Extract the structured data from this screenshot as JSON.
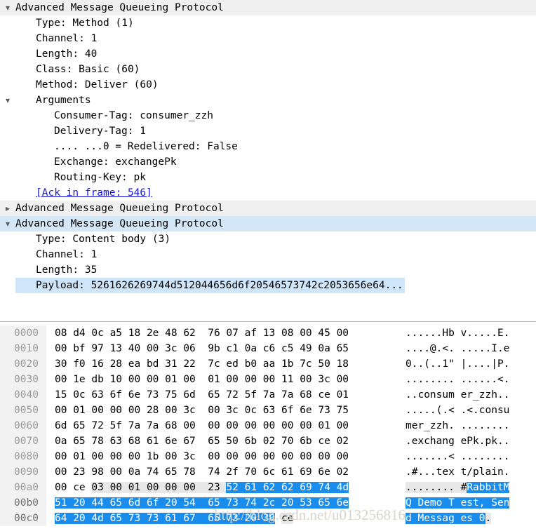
{
  "detail_pane": {
    "rows": [
      {
        "twisty": "chevron-down-icon",
        "indent": 1,
        "text": "Advanced Message Queueing Protocol",
        "bg": "gray",
        "name": "tree-item-amqp-method"
      },
      {
        "twisty": "none",
        "indent": 2,
        "text": "Type: Method (1)",
        "bg": "none",
        "name": "tree-item-type"
      },
      {
        "twisty": "none",
        "indent": 2,
        "text": "Channel: 1",
        "bg": "none",
        "name": "tree-item-channel"
      },
      {
        "twisty": "none",
        "indent": 2,
        "text": "Length: 40",
        "bg": "none",
        "name": "tree-item-length"
      },
      {
        "twisty": "none",
        "indent": 2,
        "text": "Class: Basic (60)",
        "bg": "none",
        "name": "tree-item-class"
      },
      {
        "twisty": "none",
        "indent": 2,
        "text": "Method: Deliver (60)",
        "bg": "none",
        "name": "tree-item-method"
      },
      {
        "twisty": "chevron-down-icon",
        "indent": 2,
        "text": "Arguments",
        "bg": "none",
        "name": "tree-item-arguments"
      },
      {
        "twisty": "none",
        "indent": 3,
        "text": "Consumer-Tag: consumer_zzh",
        "bg": "none",
        "name": "tree-item-consumer-tag"
      },
      {
        "twisty": "none",
        "indent": 3,
        "text": "Delivery-Tag: 1",
        "bg": "none",
        "name": "tree-item-delivery-tag"
      },
      {
        "twisty": "none",
        "indent": 3,
        "text": ".... ...0 = Redelivered: False",
        "bg": "none",
        "name": "tree-item-redelivered"
      },
      {
        "twisty": "none",
        "indent": 3,
        "text": "Exchange: exchangePk",
        "bg": "none",
        "name": "tree-item-exchange"
      },
      {
        "twisty": "none",
        "indent": 3,
        "text": "Routing-Key: pk",
        "bg": "none",
        "name": "tree-item-routing-key"
      },
      {
        "twisty": "none",
        "indent": 2,
        "text": "[Ack in frame: 546]",
        "bg": "none",
        "link": true,
        "name": "tree-item-ack-in-frame"
      },
      {
        "twisty": "chevron-right-icon",
        "indent": 1,
        "text": "Advanced Message Queueing Protocol",
        "bg": "gray",
        "name": "tree-item-amqp-header"
      },
      {
        "twisty": "chevron-down-icon",
        "indent": 1,
        "text": "Advanced Message Queueing Protocol",
        "bg": "blue",
        "name": "tree-item-amqp-body"
      },
      {
        "twisty": "none",
        "indent": 2,
        "text": "Type: Content body (3)",
        "bg": "none",
        "name": "tree-item-type-body"
      },
      {
        "twisty": "none",
        "indent": 2,
        "text": "Channel: 1",
        "bg": "none",
        "name": "tree-item-channel-body"
      },
      {
        "twisty": "none",
        "indent": 2,
        "text": "Length: 35",
        "bg": "none",
        "name": "tree-item-length-body"
      },
      {
        "twisty": "none",
        "indent": 2,
        "text": "Payload: 5261626269744d512044656d6f20546573742c2053656e64...",
        "bg": "none",
        "highlight": true,
        "name": "tree-item-payload"
      }
    ]
  },
  "hex_pane": {
    "rows": [
      {
        "offset": "0000",
        "bytes": "08 d4 0c a5 18 2e 48 62  76 07 af 13 08 00 45 00",
        "ascii": "......Hb v.....E."
      },
      {
        "offset": "0010",
        "bytes": "00 bf 97 13 40 00 3c 06  9b c1 0a c6 c5 49 0a 65",
        "ascii": "....@.<. .....I.e"
      },
      {
        "offset": "0020",
        "bytes": "30 f0 16 28 ea bd 31 22  7c ed b0 aa 1b 7c 50 18",
        "ascii": "0..(..1\" |....|P."
      },
      {
        "offset": "0030",
        "bytes": "00 1e db 10 00 00 01 00  01 00 00 00 11 00 3c 00",
        "ascii": "........ ......<."
      },
      {
        "offset": "0040",
        "bytes": "15 0c 63 6f 6e 73 75 6d  65 72 5f 7a 7a 68 ce 01",
        "ascii": "..consum er_zzh.."
      },
      {
        "offset": "0050",
        "bytes": "00 01 00 00 00 28 00 3c  00 3c 0c 63 6f 6e 73 75",
        "ascii": ".....(.< .<.consu"
      },
      {
        "offset": "0060",
        "bytes": "6d 65 72 5f 7a 7a 68 00  00 00 00 00 00 00 01 00",
        "ascii": "mer_zzh. ........"
      },
      {
        "offset": "0070",
        "bytes": "0a 65 78 63 68 61 6e 67  65 50 6b 02 70 6b ce 02",
        "ascii": ".exchang ePk.pk.."
      },
      {
        "offset": "0080",
        "bytes": "00 01 00 00 00 1b 00 3c  00 00 00 00 00 00 00 00",
        "ascii": ".......< ........"
      },
      {
        "offset": "0090",
        "bytes": "00 23 98 00 0a 74 65 78  74 2f 70 6c 61 69 6e 02",
        "ascii": ".#...tex t/plain."
      },
      {
        "offset": "00a0",
        "segments": [
          {
            "mode": "plain",
            "text": "00 ce "
          },
          {
            "mode": "soft",
            "text": "03 00 01 00 00 00  23 "
          },
          {
            "mode": "sel",
            "text": "52 61 62 62 69 74 4d"
          }
        ],
        "ascii_segments": [
          {
            "mode": "soft",
            "text": "........ #"
          },
          {
            "mode": "sel",
            "text": "RabbitM"
          }
        ]
      },
      {
        "offset": "00b0",
        "segments": [
          {
            "mode": "sel",
            "text": "51 20 44 65 6d 6f 20 54  65 73 74 2c 20 53 65 6e"
          }
        ],
        "ascii_segments": [
          {
            "mode": "sel",
            "text": "Q Demo T est, Sen"
          }
        ],
        "selected_offset": true
      },
      {
        "offset": "00c0",
        "segments": [
          {
            "mode": "sel",
            "text": "64 20 4d 65 73 73 61 67  65 73 20 30"
          },
          {
            "mode": "plain",
            "text": " "
          },
          {
            "mode": "soft",
            "text": "ce"
          }
        ],
        "ascii_segments": [
          {
            "mode": "sel",
            "text": "d Messag es 0"
          },
          {
            "mode": "soft",
            "text": "."
          }
        ],
        "selected_offset": true
      }
    ]
  },
  "watermark": {
    "text": "http://blog.csdn.net/u013256816"
  },
  "colors": {
    "selection_blue": "#1a8cec",
    "row_gray": "#f0f0f0",
    "row_blue": "#d3e7f7",
    "payload_highlight": "#cfe6fa",
    "link": "#1616d8",
    "offset_text": "#9a9a9a"
  },
  "icons": {
    "chevron_down": "⌄",
    "chevron_right": "›"
  }
}
